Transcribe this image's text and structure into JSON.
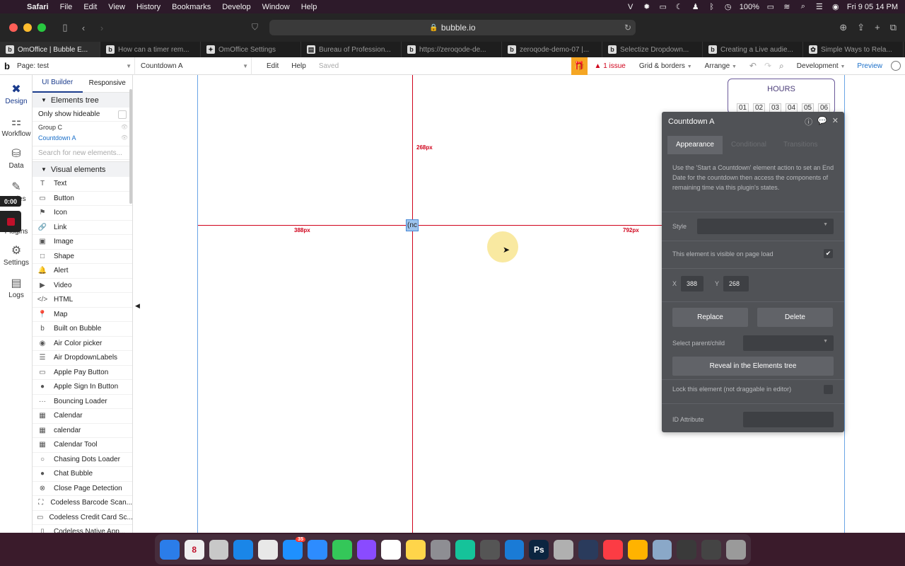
{
  "menubar": {
    "items": [
      "Safari",
      "File",
      "Edit",
      "View",
      "History",
      "Bookmarks",
      "Develop",
      "Window",
      "Help"
    ],
    "battery": "100%",
    "clock": "Fri 9 05 14 PM"
  },
  "browser": {
    "url": "bubble.io",
    "tabs": [
      {
        "label": "OmOffice | Bubble E...",
        "icon": "bubble-icon"
      },
      {
        "label": "How can a timer rem...",
        "icon": "bubble-icon"
      },
      {
        "label": "OmOffice Settings",
        "icon": "gear-icon"
      },
      {
        "label": "Bureau of Profession...",
        "icon": "page-icon"
      },
      {
        "label": "https://zeroqode-de...",
        "icon": "bubble-icon"
      },
      {
        "label": "zeroqode-demo-07 |...",
        "icon": "bubble-icon"
      },
      {
        "label": "Selectize Dropdown...",
        "icon": "bubble-icon"
      },
      {
        "label": "Creating a Live audie...",
        "icon": "bubble-icon"
      },
      {
        "label": "Simple Ways to Rela...",
        "icon": "leaf-icon"
      }
    ]
  },
  "editor": {
    "page_label": "Page: test",
    "element_label": "Countdown A",
    "edit": "Edit",
    "help": "Help",
    "saved": "Saved",
    "issues": "1 issue",
    "grid": "Grid & borders",
    "arrange": "Arrange",
    "environment": "Development",
    "preview": "Preview"
  },
  "sidenav": [
    {
      "label": "Design",
      "icon": "design-icon"
    },
    {
      "label": "Workflow",
      "icon": "workflow-icon"
    },
    {
      "label": "Data",
      "icon": "database-icon"
    },
    {
      "label": "Styles",
      "icon": "brush-icon"
    },
    {
      "label": "Plugins",
      "icon": "plugin-icon"
    },
    {
      "label": "Settings",
      "icon": "gear-icon"
    },
    {
      "label": "Logs",
      "icon": "logs-icon"
    }
  ],
  "recording_timer": "0:00",
  "palette": {
    "tab_ui_builder": "UI Builder",
    "tab_responsive": "Responsive",
    "elements_tree_heading": "Elements tree",
    "only_hideable": "Only show hideable",
    "tree": [
      "Group C",
      "Countdown A"
    ],
    "search_placeholder": "Search for new elements...",
    "visual_elements_heading": "Visual elements",
    "elements": [
      {
        "label": "Text",
        "icon": "T"
      },
      {
        "label": "Button",
        "icon": "▭"
      },
      {
        "label": "Icon",
        "icon": "⚑"
      },
      {
        "label": "Link",
        "icon": "🔗"
      },
      {
        "label": "Image",
        "icon": "▣"
      },
      {
        "label": "Shape",
        "icon": "□"
      },
      {
        "label": "Alert",
        "icon": "🔔"
      },
      {
        "label": "Video",
        "icon": "▶"
      },
      {
        "label": "HTML",
        "icon": "</>"
      },
      {
        "label": "Map",
        "icon": "📍"
      },
      {
        "label": "Built on Bubble",
        "icon": "b"
      },
      {
        "label": "Air Color picker",
        "icon": "◉"
      },
      {
        "label": "Air DropdownLabels",
        "icon": "☰"
      },
      {
        "label": "Apple Pay Button",
        "icon": "▭"
      },
      {
        "label": "Apple Sign In Button",
        "icon": "●"
      },
      {
        "label": "Bouncing Loader",
        "icon": "···"
      },
      {
        "label": "Calendar",
        "icon": "▦"
      },
      {
        "label": "calendar",
        "icon": "▦"
      },
      {
        "label": "Calendar Tool",
        "icon": "▦"
      },
      {
        "label": "Chasing Dots Loader",
        "icon": "○"
      },
      {
        "label": "Chat Bubble",
        "icon": "●"
      },
      {
        "label": "Close Page Detection",
        "icon": "⊗"
      },
      {
        "label": "Codeless Barcode Scan...",
        "icon": "⛶"
      },
      {
        "label": "Codeless Credit Card Sc...",
        "icon": "▭"
      },
      {
        "label": "Codeless Native App...",
        "icon": "▯"
      }
    ]
  },
  "canvas": {
    "top_offset": "268px",
    "left_offset": "388px",
    "right_offset": "792px",
    "element_text": "(nc",
    "hours_label": "HOURS",
    "hours": [
      "01",
      "02",
      "03",
      "04",
      "05",
      "06"
    ]
  },
  "panel": {
    "title": "Countdown A",
    "tabs": [
      "Appearance",
      "Conditional",
      "Transitions"
    ],
    "description": "Use the 'Start a Countdown' element action to set an End Date for the countdown then access the components of remaining time via this plugin's states.",
    "style_label": "Style",
    "visible_label": "This element is visible on page load",
    "visible_checked": true,
    "x_label": "X",
    "x_value": "388",
    "y_label": "Y",
    "y_value": "268",
    "replace": "Replace",
    "delete": "Delete",
    "parent_child_label": "Select parent/child",
    "reveal": "Reveal in the Elements tree",
    "lock_label": "Lock this element (not draggable in editor)",
    "id_label": "ID Attribute"
  },
  "dock": [
    {
      "name": "finder",
      "color": "#2b7de9"
    },
    {
      "name": "calendar",
      "color": "#f0f0f0",
      "label": "8"
    },
    {
      "name": "launchpad",
      "color": "#c8c8c8"
    },
    {
      "name": "safari",
      "color": "#1a86e8"
    },
    {
      "name": "chrome",
      "color": "#e8e8e8"
    },
    {
      "name": "app-store",
      "color": "#1e90ff",
      "badge": "35"
    },
    {
      "name": "zoom",
      "color": "#2d8cff"
    },
    {
      "name": "messages",
      "color": "#34c759"
    },
    {
      "name": "messenger",
      "color": "#8a4bff"
    },
    {
      "name": "slack",
      "color": "#ffffff"
    },
    {
      "name": "notes",
      "color": "#ffd54a"
    },
    {
      "name": "system-preferences",
      "color": "#8e8e93"
    },
    {
      "name": "grammarly",
      "color": "#15c39a"
    },
    {
      "name": "calculator",
      "color": "#555"
    },
    {
      "name": "chat",
      "color": "#1a7bd6"
    },
    {
      "name": "photoshop",
      "color": "#0b2540",
      "label": "Ps"
    },
    {
      "name": "preview",
      "color": "#b0b0b0"
    },
    {
      "name": "vpn",
      "color": "#2a3b5c"
    },
    {
      "name": "music",
      "color": "#fc3c44"
    },
    {
      "name": "home",
      "color": "#ffb300"
    },
    {
      "name": "screenshot",
      "color": "#8aa8c8"
    },
    {
      "name": "automator",
      "color": "#3a3a3a"
    },
    {
      "name": "video-editor",
      "color": "#444"
    },
    {
      "name": "trash",
      "color": "#9a9a9a"
    }
  ]
}
